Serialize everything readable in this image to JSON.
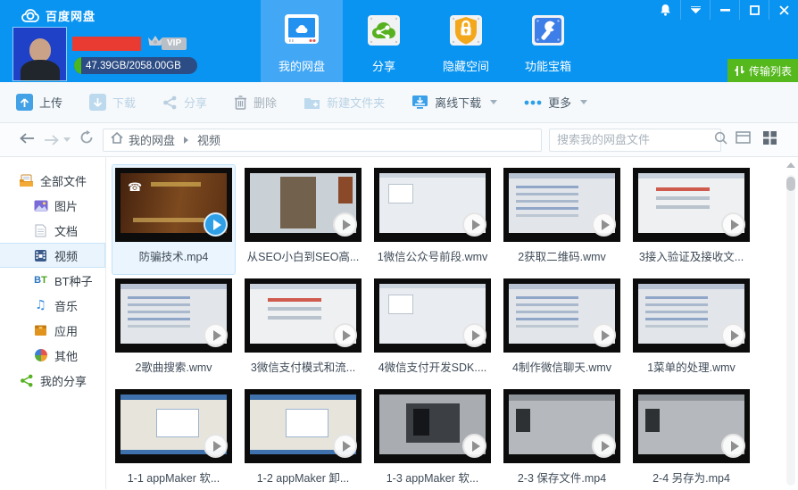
{
  "app": {
    "title": "百度网盘"
  },
  "window_controls": {
    "bell": "notifications",
    "collapse": "collapse-window",
    "minimize": "minimize",
    "maximize": "maximize",
    "close": "close"
  },
  "user": {
    "vip_label": "VIP",
    "storage_text": "47.39GB/2058.00GB"
  },
  "tabs": [
    {
      "label": "我的网盘",
      "icon": "my-drive",
      "active": true
    },
    {
      "label": "分享",
      "icon": "share-cloud",
      "active": false
    },
    {
      "label": "隐藏空间",
      "icon": "hidden-space",
      "active": false
    },
    {
      "label": "功能宝箱",
      "icon": "toolbox",
      "active": false
    }
  ],
  "transfer_button": {
    "label": "传输列表"
  },
  "toolbar": [
    {
      "label": "上传",
      "icon": "upload",
      "state": "enabled",
      "caret": false
    },
    {
      "label": "下载",
      "icon": "download",
      "state": "disabled",
      "caret": false
    },
    {
      "label": "分享",
      "icon": "share",
      "state": "disabled",
      "caret": false
    },
    {
      "label": "删除",
      "icon": "trash",
      "state": "disabled-dark",
      "caret": false
    },
    {
      "label": "新建文件夹",
      "icon": "new-folder",
      "state": "disabled",
      "caret": false
    },
    {
      "label": "离线下载",
      "icon": "offline-download",
      "state": "enabled",
      "caret": true
    },
    {
      "label": "更多",
      "icon": "more-dots",
      "state": "enabled",
      "caret": true
    }
  ],
  "nav": {
    "crumb_root": "我的网盘",
    "crumb_current": "视频",
    "search_placeholder": "搜索我的网盘文件"
  },
  "sidebar": [
    {
      "label": "全部文件",
      "icon": "all-files",
      "indent": false,
      "selected": false
    },
    {
      "label": "图片",
      "icon": "pictures",
      "indent": true,
      "selected": false
    },
    {
      "label": "文档",
      "icon": "documents",
      "indent": true,
      "selected": false
    },
    {
      "label": "视频",
      "icon": "videos",
      "indent": true,
      "selected": true
    },
    {
      "label": "BT种子",
      "icon": "bt-seed",
      "indent": true,
      "selected": false
    },
    {
      "label": "音乐",
      "icon": "music",
      "indent": true,
      "selected": false
    },
    {
      "label": "应用",
      "icon": "apps",
      "indent": true,
      "selected": false
    },
    {
      "label": "其他",
      "icon": "others",
      "indent": true,
      "selected": false
    },
    {
      "label": "我的分享",
      "icon": "my-share",
      "indent": false,
      "selected": false
    }
  ],
  "files": [
    {
      "name": "防骗技术.mp4",
      "variant": "brown",
      "selected": true
    },
    {
      "name": "从SEO小白到SEO高...",
      "variant": "seo",
      "selected": false
    },
    {
      "name": "1微信公众号前段.wmv",
      "variant": "pale",
      "selected": false
    },
    {
      "name": "2获取二维码.wmv",
      "variant": "code",
      "selected": false
    },
    {
      "name": "3接入验证及接收文...",
      "variant": "doc",
      "selected": false
    },
    {
      "name": "2歌曲搜索.wmv",
      "variant": "code",
      "selected": false
    },
    {
      "name": "3微信支付模式和流...",
      "variant": "doc",
      "selected": false
    },
    {
      "name": "4微信支付开发SDK....",
      "variant": "pale",
      "selected": false
    },
    {
      "name": "4制作微信聊天.wmv",
      "variant": "code",
      "selected": false
    },
    {
      "name": "1菜单的处理.wmv",
      "variant": "code",
      "selected": false
    },
    {
      "name": "1-1  appMaker 软...",
      "variant": "xp",
      "selected": false
    },
    {
      "name": "1-2  appMaker 卸...",
      "variant": "xp",
      "selected": false
    },
    {
      "name": "1-3  appMaker 软...",
      "variant": "ps",
      "selected": false
    },
    {
      "name": "2-3  保存文件.mp4",
      "variant": "ps2",
      "selected": false
    },
    {
      "name": "2-4  另存为.mp4",
      "variant": "ps2",
      "selected": false
    }
  ],
  "colors": {
    "header_blue": "#0a94f1",
    "tab_active_blue": "#42a7f5",
    "transfer_green": "#55b81d",
    "storage_pill_navy": "#2b4c84",
    "storage_used_green": "#49b81f",
    "accent_blue": "#2f9fe8",
    "selected_card_bg": "#eaf5fd"
  }
}
